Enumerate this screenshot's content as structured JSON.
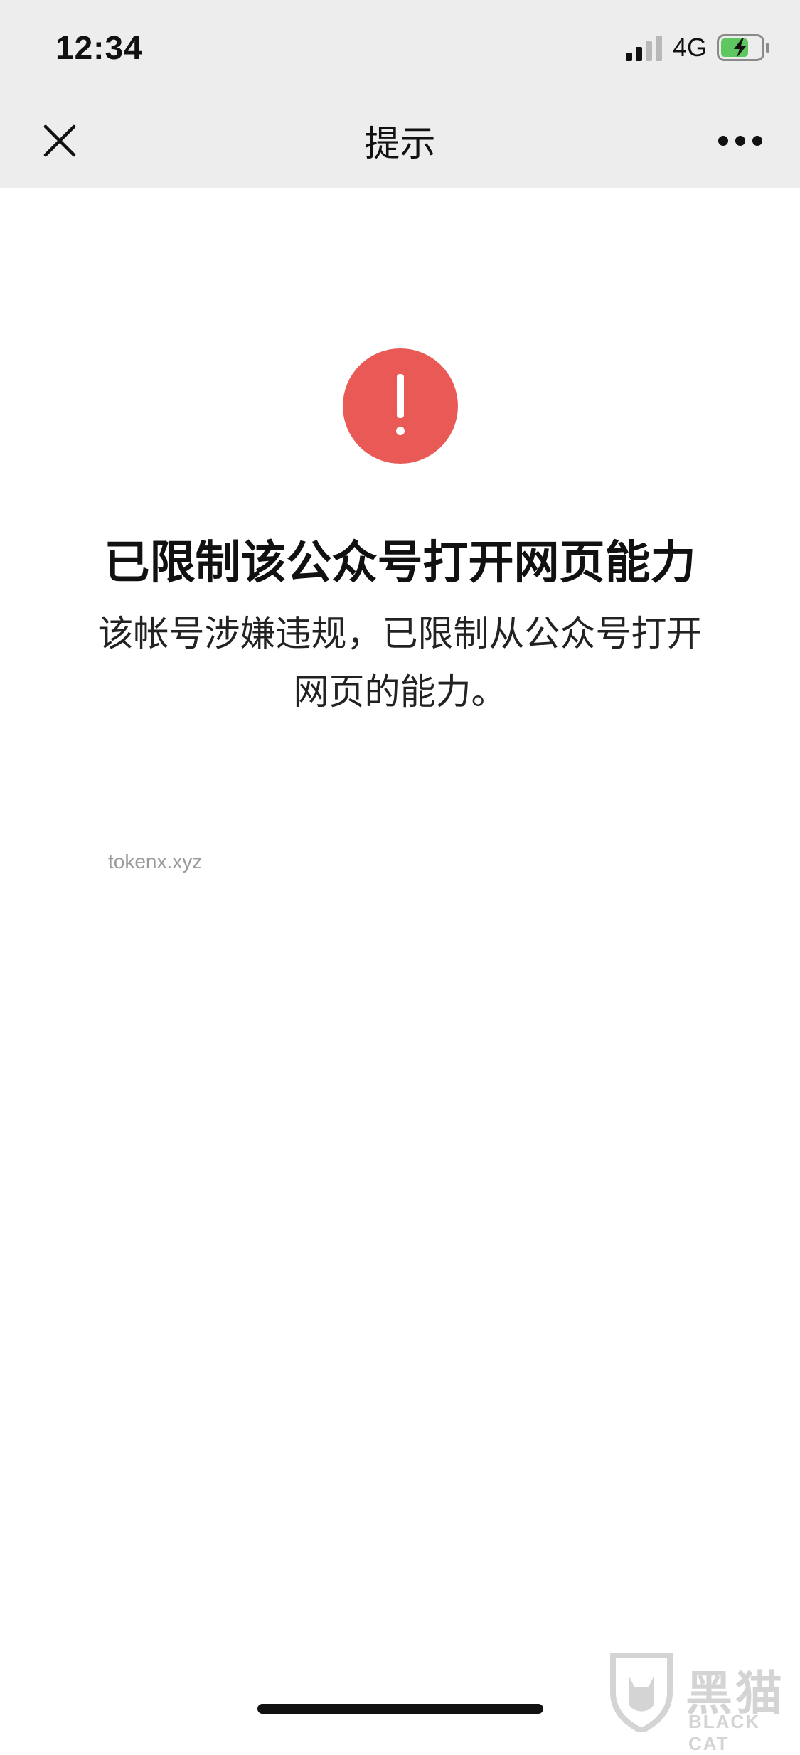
{
  "status_bar": {
    "time": "12:34",
    "network": "4G",
    "icons": {
      "signal": "signal-icon",
      "battery": "battery-charging-icon"
    }
  },
  "nav": {
    "title": "提示",
    "close_icon": "close-icon",
    "more_icon": "more-icon"
  },
  "alert": {
    "icon": "alert-icon",
    "icon_color": "#e95a56",
    "headline": "已限制该公众号打开网页能力",
    "description_line1": "该帐号涉嫌违规，已限制从公众号打开",
    "description_line2": "网页的能力。",
    "domain": "tokenx.xyz"
  },
  "watermark": {
    "logo_text": "黑猫",
    "sub_text": "BLACK CAT",
    "icon": "cat-shield-icon"
  },
  "colors": {
    "nav_background": "#ededed",
    "battery_green": "#5fc75f"
  }
}
